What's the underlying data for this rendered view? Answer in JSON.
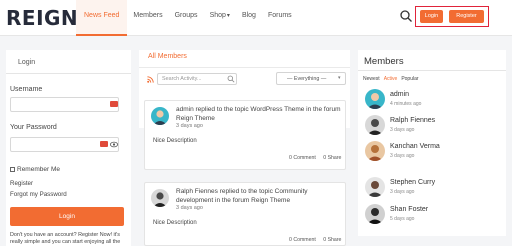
{
  "header": {
    "logo": "REIGN",
    "nav": [
      "News Feed",
      "Members",
      "Groups",
      "Shop",
      "Blog",
      "Forums"
    ],
    "login_label": "Login",
    "register_label": "Register"
  },
  "login": {
    "title": "Login",
    "username_label": "Username",
    "password_label": "Your Password",
    "remember_label": "Remember Me",
    "register_link": "Register",
    "forgot_link": "Forgot my Password",
    "button_label": "Login",
    "promo": "Don't you have an account? Register Now! it's really simple and you can start enjoying all the"
  },
  "activity": {
    "title": "All Members",
    "search_placeholder": "Search Activity...",
    "filter_value": "— Everything —",
    "cards": [
      {
        "text": "admin replied to the topic WordPress Theme in the forum Reign Theme",
        "time": "3 days ago",
        "desc": "Nice Description",
        "comment": "0 Comment",
        "share": "0 Share"
      },
      {
        "text": "Ralph Fiennes replied to the topic Community development in the forum Reign Theme",
        "time": "3 days ago",
        "desc": "Nice Description",
        "comment": "0 Comment",
        "share": "0 Share"
      }
    ]
  },
  "members": {
    "title": "Members",
    "tabs": [
      "Newest",
      "Active",
      "Popular"
    ],
    "list": [
      {
        "name": "admin",
        "time": "4 minutes ago"
      },
      {
        "name": "Ralph Fiennes",
        "time": "3 days ago"
      },
      {
        "name": "Kanchan Verma",
        "time": "3 days ago"
      },
      {
        "name": "Stephen Curry",
        "time": "3 days ago"
      },
      {
        "name": "Shan Foster",
        "time": "5 days ago"
      }
    ]
  },
  "colors": {
    "accent": "#f26c32",
    "highlight_border": "#e0233a"
  }
}
